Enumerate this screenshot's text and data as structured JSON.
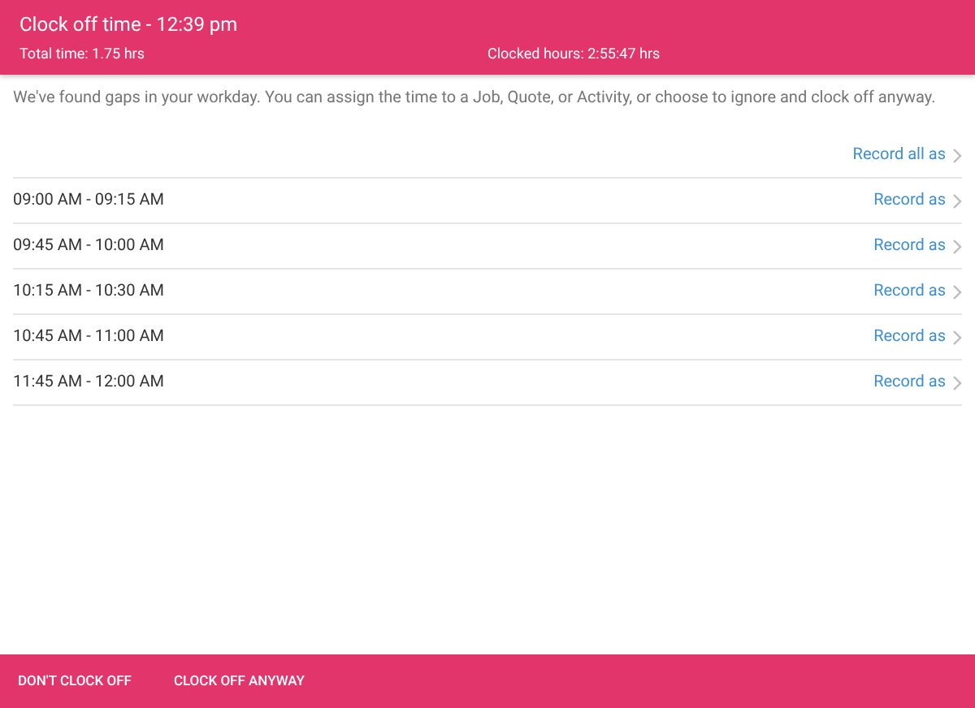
{
  "header": {
    "title": "Clock off time - 12:39 pm",
    "total_time": "Total time: 1.75 hrs",
    "clocked_hours": "Clocked hours: 2:55:47 hrs"
  },
  "message": "We've found gaps in your workday. You can assign the time to a Job, Quote, or Activity, or choose to ignore and clock off anyway.",
  "record_all": "Record all as",
  "gaps": [
    {
      "time": "09:00 AM - 09:15 AM",
      "action": "Record as"
    },
    {
      "time": "09:45 AM - 10:00 AM",
      "action": "Record as"
    },
    {
      "time": "10:15 AM - 10:30 AM",
      "action": "Record as"
    },
    {
      "time": "10:45 AM - 11:00 AM",
      "action": "Record as"
    },
    {
      "time": "11:45 AM - 12:00 AM",
      "action": "Record as"
    }
  ],
  "footer_buttons": [
    "DON'T CLOCK OFF",
    "CLOCK OFF ANYWAY"
  ]
}
